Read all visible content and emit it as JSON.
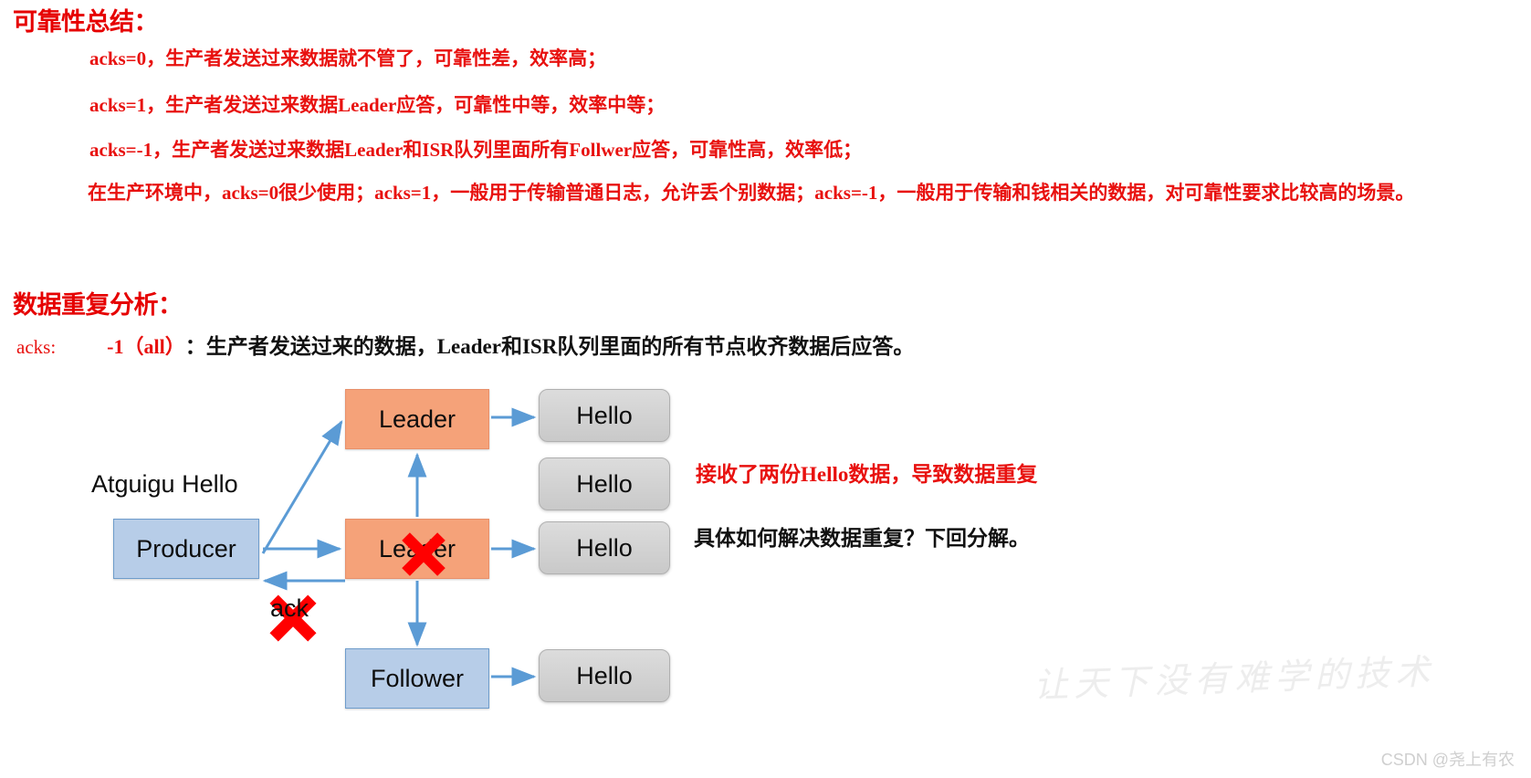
{
  "slide": {
    "headings": {
      "reliability": "可靠性总结：",
      "duplicate": "数据重复分析："
    },
    "acks_summary": [
      "acks=0，生产者发送过来数据就不管了，可靠性差，效率高；",
      "acks=1，生产者发送过来数据Leader应答，可靠性中等，效率中等；",
      "acks=-1，生产者发送过来数据Leader和ISR队列里面所有Follwer应答，可靠性高，效率低；"
    ],
    "production_note": "在生产环境中，acks=0很少使用；acks=1，一般用于传输普通日志，允许丢个别数据；acks=-1，一般用于传输和钱相关的数据，对可靠性要求比较高的场景。",
    "acks_all": {
      "label": "acks:",
      "value": "-1（all）",
      "description": "：生产者发送过来的数据，Leader和ISR队列里面的所有节点收齐数据后应答。"
    },
    "diagram": {
      "producer_input_label": "Atguigu Hello",
      "producer": "Producer",
      "leader_top": "Leader",
      "leader_mid": "Leader",
      "follower": "Follower",
      "ack_label": "ack",
      "hello_boxes": [
        "Hello",
        "Hello",
        "Hello",
        "Hello"
      ],
      "failure_marks": [
        "x-mark-on-leader",
        "x-mark-on-ack"
      ]
    },
    "annotations": {
      "red": "接收了两份Hello数据，导致数据重复",
      "black": "具体如何解决数据重复？下回分解。"
    },
    "watermarks": {
      "slogan": "让天下没有难学的技术",
      "credit": "CSDN @尧上有农"
    },
    "colors": {
      "heading_red": "#E60000",
      "body_red": "#E8110F",
      "leader_fill": "#F5A279",
      "blue_fill": "#B7CDE8",
      "hello_fill": "#D0D0D0",
      "arrow_blue": "#5B9BD5",
      "x_red": "#FF0000"
    }
  }
}
